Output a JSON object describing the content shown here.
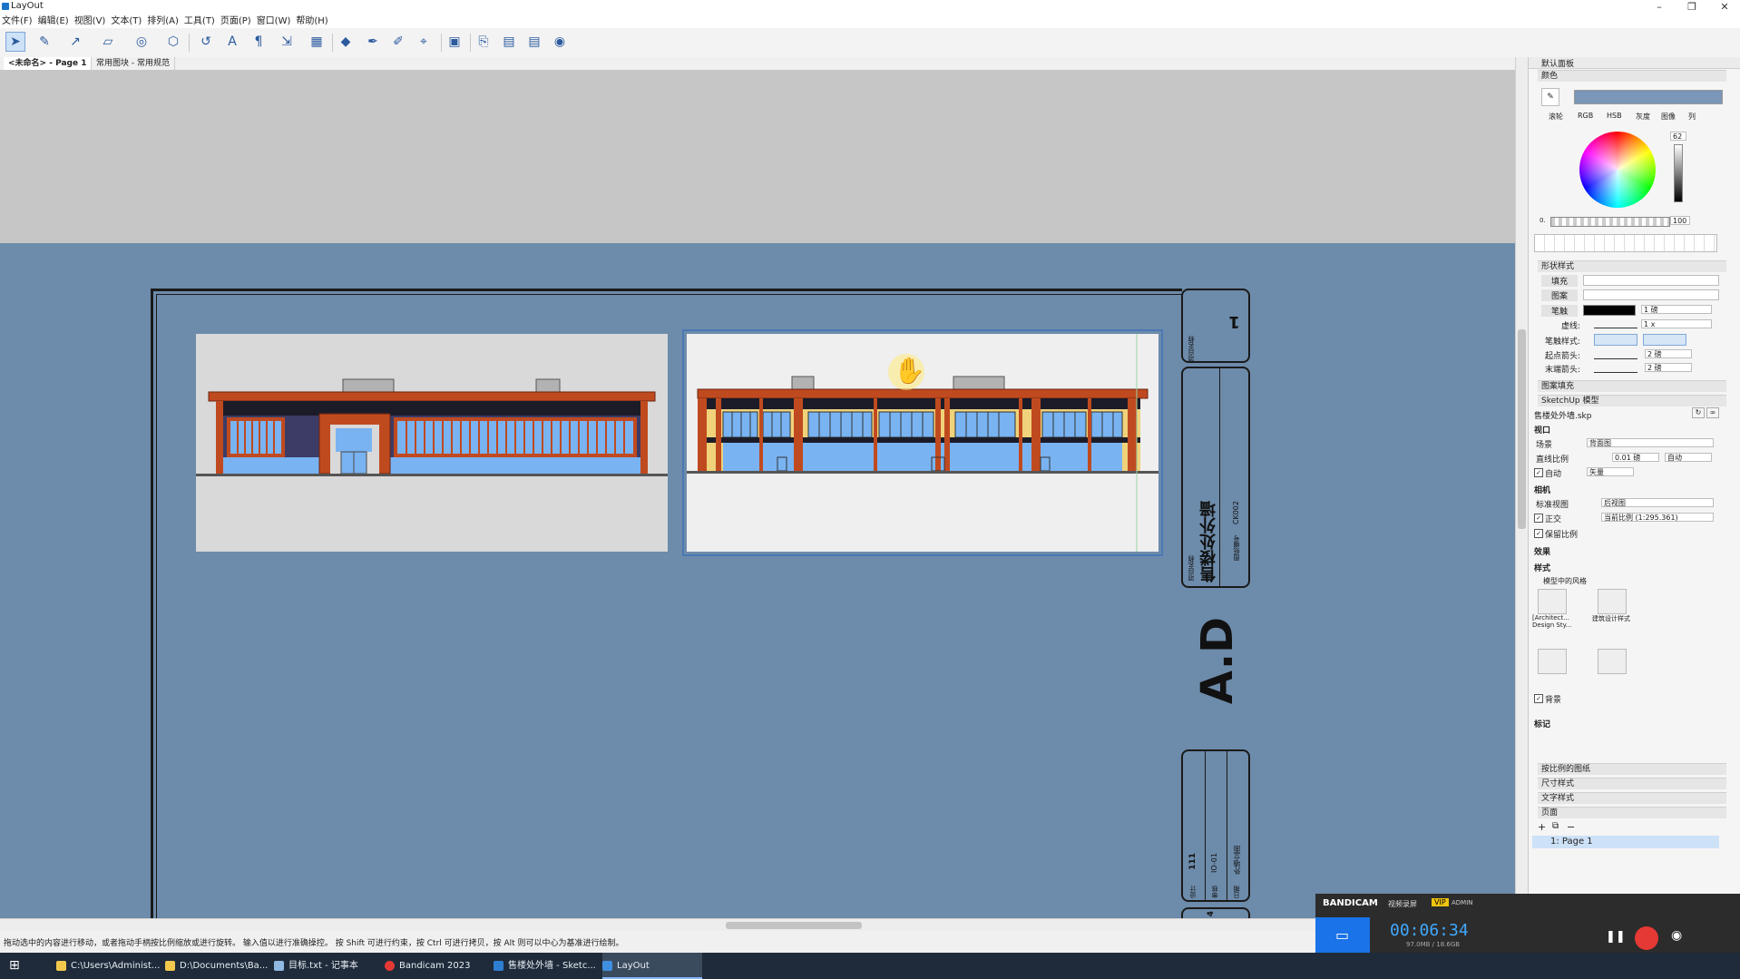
{
  "window": {
    "title": "LayOut"
  },
  "menu": [
    "文件(F)",
    "编辑(E)",
    "视图(V)",
    "文本(T)",
    "排列(A)",
    "工具(T)",
    "页面(P)",
    "窗口(W)",
    "帮助(H)"
  ],
  "tabs": [
    {
      "label": "<未命名> - Page 1"
    },
    {
      "label": "常用图块 - 常用规范"
    }
  ],
  "titleblock": {
    "page_no": "1",
    "project_name": "售楼处外墙",
    "field_label_1": "项目名称",
    "field_label_2": "图纸编号",
    "drawing_code": "CK002",
    "side_text": "A.D",
    "col1": "111",
    "col2": "IO-01",
    "col3": "外墙立面",
    "sub1": "设计",
    "sub2": "审核",
    "sub3": "日期",
    "bottom_no": "4"
  },
  "panel": {
    "tray_title": "默认面板",
    "colors": {
      "section": "颜色",
      "tabs": [
        "滚轮",
        "RGB",
        "HSB",
        "灰度",
        "图像",
        "列"
      ],
      "brightness": "62",
      "opacity": "100",
      "swatch": "#7a96b8",
      "opacity_prefix": "0."
    },
    "shape_style": {
      "section": "形状样式",
      "fill": "填充",
      "pattern": "图案",
      "stroke": "笔触",
      "stroke_width": "1 磅",
      "dash": "虚线:",
      "dash_scale": "1 x",
      "stroke_style": "笔触样式:",
      "start_arrow": "起点箭头:",
      "start_size": "2 磅",
      "end_arrow": "末端箭头:",
      "end_size": "2 磅",
      "stroke_color": "#000000"
    },
    "pattern_fill": "图案填充",
    "sketchup": {
      "section": "SketchUp 模型",
      "file": "售楼处外墙.skp",
      "viewport": "视口",
      "scene_label": "场景",
      "scene": "背面图",
      "line_scale_label": "直线比例",
      "line_scale": "0.01 磅",
      "auto_label": "自动",
      "render_auto": "自动",
      "render_mode": "矢量",
      "camera": "相机",
      "std_view_label": "标准视图",
      "std_view": "后视图",
      "ortho": "正交",
      "scale": "当前比例 (1:295.361)",
      "keep_ratio": "保留比例",
      "effects": "效果",
      "styles": "样式",
      "styles_in_model": "模型中的风格",
      "style1": "[Architect... Design Sty...",
      "style2": "建筑设计样式",
      "background": "背景",
      "tags": "标记"
    },
    "other_sections": [
      "按比例的图纸",
      "尺寸样式",
      "文字样式",
      "页面"
    ],
    "pages": [
      {
        "label": "1: Page 1"
      }
    ]
  },
  "status_text": "拖动选中的内容进行移动，或者拖动手柄按比例缩放或进行旋转。 输入值以进行准确操控。 按 Shift 可进行约束，按 Ctrl 可进行拷贝，按 Alt 则可以中心为基准进行绘制。",
  "taskbar": {
    "items": [
      {
        "label": "C:\\Users\\Administ..."
      },
      {
        "label": "D:\\Documents\\Ba..."
      },
      {
        "label": "目标.txt - 记事本"
      },
      {
        "label": "Bandicam 2023"
      },
      {
        "label": "售楼处外墙 - Sketc..."
      },
      {
        "label": "LayOut"
      }
    ]
  },
  "bandicam": {
    "brand": "BANDICAM",
    "mode": "视频录屏",
    "vip": "VIP",
    "admin": "ADMIN",
    "time": "00:06:34",
    "size": "97.0MB / 18.6GB"
  },
  "colors": {
    "paper": "#6d8baa",
    "canvas_bg": "#c6c6c6",
    "brick": "#c04a1f",
    "glass": "#79b3f2",
    "accent": "#4a78b5"
  }
}
